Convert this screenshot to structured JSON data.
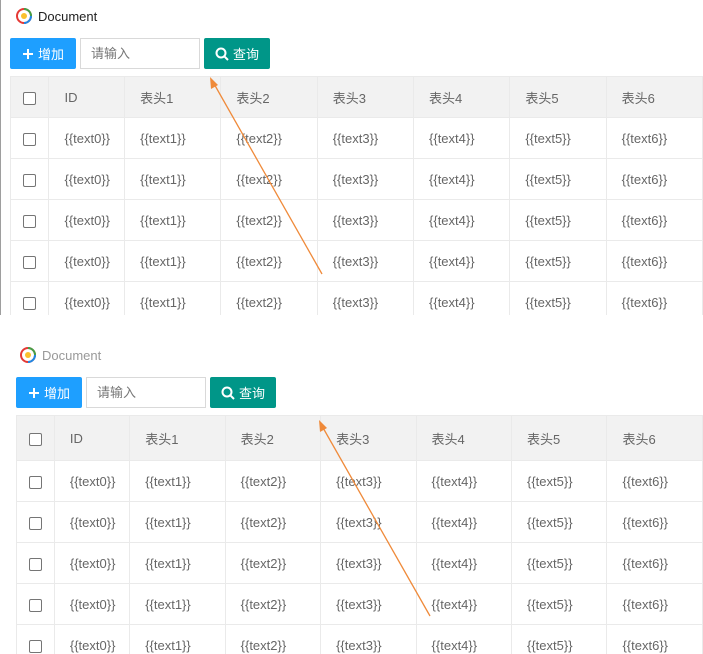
{
  "document": {
    "title": "Document"
  },
  "toolbar": {
    "add_label": "增加",
    "search_placeholder": "请输入",
    "search_label": "查询"
  },
  "table": {
    "headers": [
      "ID",
      "表头1",
      "表头2",
      "表头3",
      "表头4",
      "表头5",
      "表头6"
    ],
    "rows": [
      [
        "{{text0}}",
        "{{text1}}",
        "{{text2}}",
        "{{text3}}",
        "{{text4}}",
        "{{text5}}",
        "{{text6}}"
      ],
      [
        "{{text0}}",
        "{{text1}}",
        "{{text2}}",
        "{{text3}}",
        "{{text4}}",
        "{{text5}}",
        "{{text6}}"
      ],
      [
        "{{text0}}",
        "{{text1}}",
        "{{text2}}",
        "{{text3}}",
        "{{text4}}",
        "{{text5}}",
        "{{text6}}"
      ],
      [
        "{{text0}}",
        "{{text1}}",
        "{{text2}}",
        "{{text3}}",
        "{{text4}}",
        "{{text5}}",
        "{{text6}}"
      ],
      [
        "{{text0}}",
        "{{text1}}",
        "{{text2}}",
        "{{text3}}",
        "{{text4}}",
        "{{text5}}",
        "{{text6}}"
      ]
    ]
  },
  "colors": {
    "add_button": "#1E9FFF",
    "search_button": "#009688",
    "header_bg": "#f2f2f2",
    "annotation_arrow": "#ef8a3a"
  },
  "icons": {
    "add": "plus-icon",
    "search": "search-icon",
    "logo": "app-logo-icon"
  }
}
